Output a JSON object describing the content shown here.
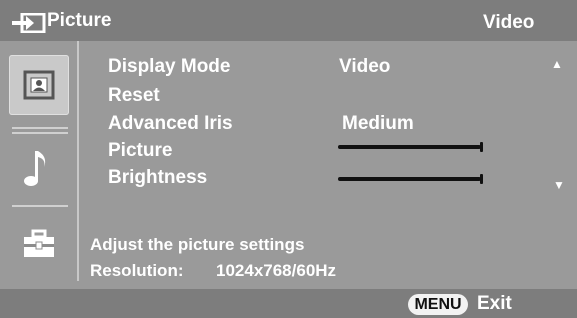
{
  "header": {
    "title": "Picture",
    "source": "Video",
    "input_icon": "input-arrow-icon"
  },
  "sidebar": {
    "tabs": [
      {
        "name": "picture",
        "icon": "picture-icon",
        "selected": true
      },
      {
        "name": "sound",
        "icon": "music-note-icon",
        "selected": false
      },
      {
        "name": "setup",
        "icon": "toolbox-icon",
        "selected": false
      }
    ]
  },
  "menu": {
    "items": [
      {
        "label": "Display Mode",
        "value": "Video"
      },
      {
        "label": "Reset"
      },
      {
        "label": "Advanced Iris",
        "value": "Medium"
      },
      {
        "label": "Picture",
        "level": 1.0
      },
      {
        "label": "Brightness",
        "level": 1.0
      }
    ],
    "scroll_up_icon": "▲",
    "scroll_down_icon": "▼"
  },
  "help": {
    "description": "Adjust the picture settings",
    "resolution_label": "Resolution:",
    "resolution_value": "1024x768/60Hz"
  },
  "footer": {
    "menu_key": "MENU",
    "exit_label": "Exit"
  },
  "colors": {
    "panel": "#9a9a9a",
    "header": "#7d7d7d",
    "text": "#ffffff",
    "slider": "#111111"
  }
}
